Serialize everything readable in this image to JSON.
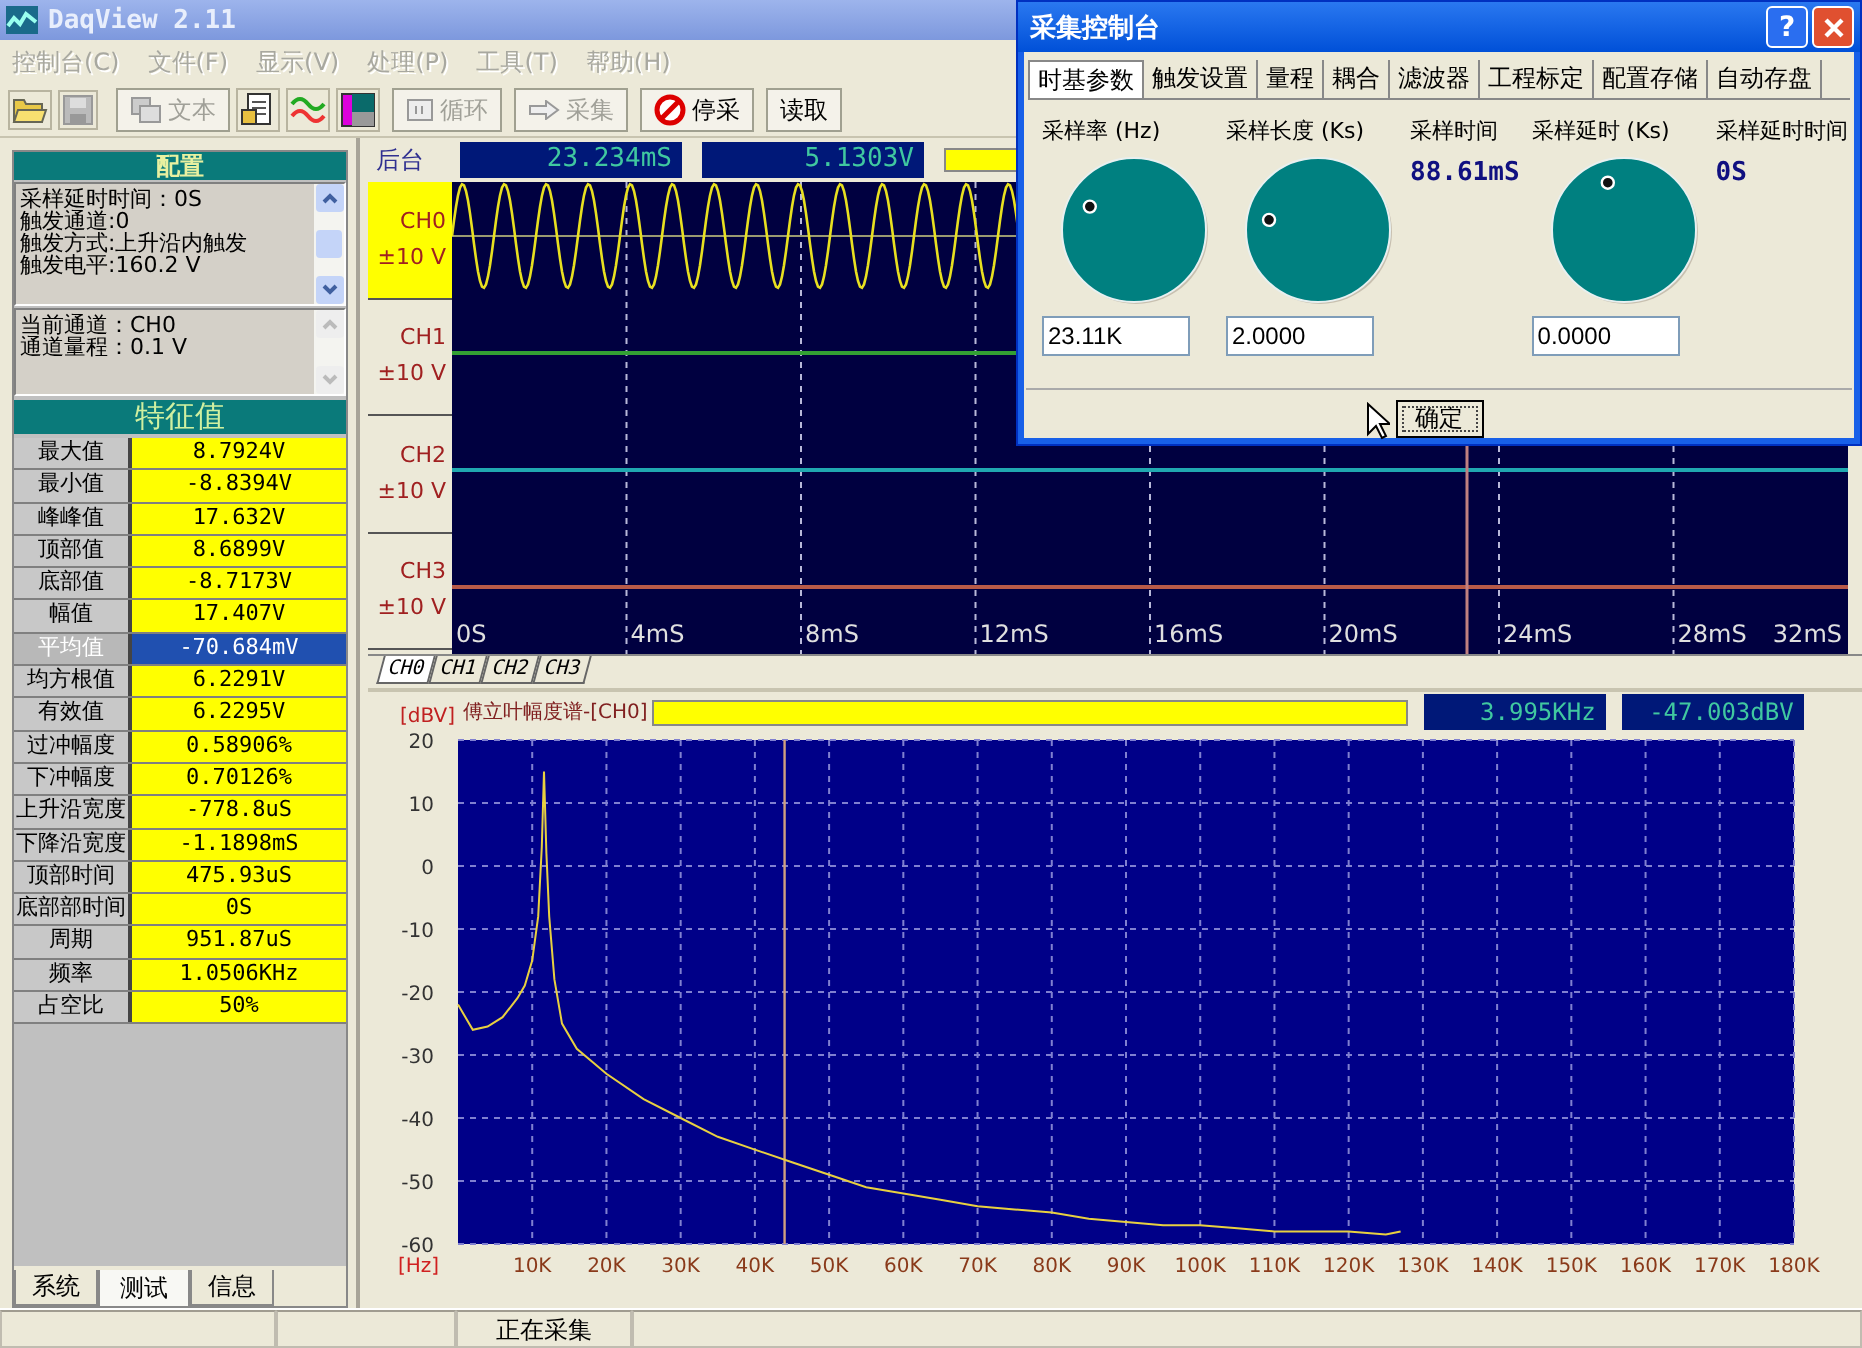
{
  "window": {
    "title": "DaqView 2.11"
  },
  "menu": [
    {
      "label": "控制台(C)",
      "disabled": true
    },
    {
      "label": "文件(F)",
      "disabled": true
    },
    {
      "label": "显示(V)",
      "disabled": true
    },
    {
      "label": "处理(P)",
      "disabled": true
    },
    {
      "label": "工具(T)",
      "disabled": true
    },
    {
      "label": "帮助(H)",
      "disabled": true
    }
  ],
  "toolbar": {
    "buttons": [
      {
        "label": "文本",
        "disabled": true
      },
      {
        "label": "循环",
        "disabled": true
      },
      {
        "label": "采集",
        "disabled": true
      },
      {
        "label": "停采",
        "disabled": false
      },
      {
        "label": "读取",
        "disabled": false
      }
    ]
  },
  "config_panel": {
    "title": "配置",
    "lines": [
      "采样延时时间：0S",
      "触发通道:0",
      "触发方式:上升沿内触发",
      "触发电平:160.2 V"
    ]
  },
  "channel_info": {
    "lines": [
      "当前通道：CH0",
      "通道量程：0.1 V"
    ]
  },
  "features": {
    "title": "特征值",
    "rows": [
      {
        "name": "最大值",
        "value": "8.7924V",
        "selected": false
      },
      {
        "name": "最小值",
        "value": "-8.8394V",
        "selected": false
      },
      {
        "name": "峰峰值",
        "value": "17.632V",
        "selected": false
      },
      {
        "name": "顶部值",
        "value": "8.6899V",
        "selected": false
      },
      {
        "name": "底部值",
        "value": "-8.7173V",
        "selected": false
      },
      {
        "name": "幅值",
        "value": "17.407V",
        "selected": false
      },
      {
        "name": "平均值",
        "value": "-70.684mV",
        "selected": true
      },
      {
        "name": "均方根值",
        "value": "6.2291V",
        "selected": false
      },
      {
        "name": "有效值",
        "value": "6.2295V",
        "selected": false
      },
      {
        "name": "过冲幅度",
        "value": "0.58906%",
        "selected": false
      },
      {
        "name": "下冲幅度",
        "value": "0.70126%",
        "selected": false
      },
      {
        "name": "上升沿宽度",
        "value": "-778.8uS",
        "selected": false
      },
      {
        "name": "下降沿宽度",
        "value": "-1.1898mS",
        "selected": false
      },
      {
        "name": "顶部时间",
        "value": "475.93uS",
        "selected": false
      },
      {
        "name": "底部部时间",
        "value": "0S",
        "selected": false
      },
      {
        "name": "周期",
        "value": "951.87uS",
        "selected": false
      },
      {
        "name": "频率",
        "value": "1.0506KHz",
        "selected": false
      },
      {
        "name": "占空比",
        "value": "50%",
        "selected": false
      }
    ]
  },
  "left_tabs": [
    {
      "label": "系统",
      "selected": false
    },
    {
      "label": "测试",
      "selected": true
    },
    {
      "label": "信息",
      "selected": false
    }
  ],
  "scope": {
    "header_label": "后台",
    "readouts": [
      "23.234mS",
      "5.1303V"
    ],
    "cursor": {
      "level": 0.726
    },
    "channels": [
      {
        "name": "CH0",
        "range": "±10 V",
        "selected": true,
        "color": "#e8e020"
      },
      {
        "name": "CH1",
        "range": "±10 V",
        "selected": false,
        "color": "#33a033"
      },
      {
        "name": "CH2",
        "range": "±10 V",
        "selected": false,
        "color": "#20a8b0"
      },
      {
        "name": "CH3",
        "range": "±10 V",
        "selected": false,
        "color": "#b85a48"
      }
    ],
    "time_ticks": [
      "0S",
      "4mS",
      "8mS",
      "12mS",
      "16mS",
      "20mS",
      "24mS",
      "28mS",
      "32mS"
    ],
    "tabs": [
      {
        "label": "CH0",
        "selected": true
      },
      {
        "label": "CH1",
        "selected": false
      },
      {
        "label": "CH2",
        "selected": false
      },
      {
        "label": "CH3",
        "selected": false
      }
    ]
  },
  "spectrum": {
    "readouts": [
      "3.995KHz",
      "-47.003dBV"
    ],
    "chart_data": {
      "type": "line",
      "title": "傅立叶幅度谱-[CH0]",
      "xlabel": "[Hz]",
      "ylabel": "[dBV]",
      "x": [
        0,
        2000,
        4000,
        6000,
        8000,
        9000,
        10000,
        10800,
        11300,
        11600,
        11900,
        12300,
        13000,
        14000,
        16000,
        18000,
        20000,
        25000,
        30000,
        35000,
        40000,
        45000,
        50000,
        55000,
        60000,
        65000,
        70000,
        75000,
        80000,
        85000,
        90000,
        95000,
        100000,
        105000,
        110000,
        115000,
        120000,
        125000,
        127000
      ],
      "series": [
        {
          "color": "#e8d040",
          "values": [
            -22,
            -26,
            -25.5,
            -24,
            -21,
            -19,
            -15,
            -8,
            3,
            15,
            2,
            -8,
            -18,
            -25,
            -29,
            -31,
            -33,
            -37,
            -40,
            -43,
            -45,
            -47,
            -49,
            -51,
            -52,
            -53,
            -54,
            -54.5,
            -55,
            -56,
            -56.5,
            -57,
            -57,
            -57.5,
            -58,
            -58,
            -58,
            -58.5,
            -58
          ]
        }
      ],
      "xlim": [
        0,
        180000
      ],
      "ylim": [
        -60,
        20
      ],
      "xticks": [
        {
          "value": 10000,
          "label": "10K"
        },
        {
          "value": 20000,
          "label": "20K"
        },
        {
          "value": 30000,
          "label": "30K"
        },
        {
          "value": 40000,
          "label": "40K"
        },
        {
          "value": 50000,
          "label": "50K"
        },
        {
          "value": 60000,
          "label": "60K"
        },
        {
          "value": 70000,
          "label": "70K"
        },
        {
          "value": 80000,
          "label": "80K"
        },
        {
          "value": 90000,
          "label": "90K"
        },
        {
          "value": 100000,
          "label": "100K"
        },
        {
          "value": 110000,
          "label": "110K"
        },
        {
          "value": 120000,
          "label": "120K"
        },
        {
          "value": 130000,
          "label": "130K"
        },
        {
          "value": 140000,
          "label": "140K"
        },
        {
          "value": 150000,
          "label": "150K"
        },
        {
          "value": 160000,
          "label": "160K"
        },
        {
          "value": 170000,
          "label": "170K"
        },
        {
          "value": 180000,
          "label": "180K"
        }
      ],
      "yticks": [
        -60,
        -50,
        -40,
        -30,
        -20,
        -10,
        0,
        10,
        20
      ],
      "grid": true,
      "ref_lines": [
        {
          "axis": "x",
          "value": 44000,
          "color": "#d0a080"
        }
      ]
    }
  },
  "status_bar": {
    "text": "正在采集"
  },
  "dialog": {
    "title": "采集控制台",
    "help_button": "?",
    "tabs": [
      {
        "label": "时基参数",
        "selected": true
      },
      {
        "label": "触发设置",
        "selected": false
      },
      {
        "label": "量程",
        "selected": false
      },
      {
        "label": "耦合",
        "selected": false
      },
      {
        "label": "滤波器",
        "selected": false
      },
      {
        "label": "工程标定",
        "selected": false
      },
      {
        "label": "配置存储",
        "selected": false
      },
      {
        "label": "自动存盘",
        "selected": false
      }
    ],
    "columns": [
      {
        "kind": "knob",
        "label": "采样率 (Hz)",
        "level": 0.27,
        "value": "23.11K"
      },
      {
        "kind": "knob",
        "label": "采样长度 (Ks)",
        "level": 0.21,
        "value": "2.0000"
      },
      {
        "kind": "readout",
        "label": "采样时间",
        "value": "88.61mS"
      },
      {
        "kind": "knob",
        "label": "采样延时 (Ks)",
        "level": 0.43,
        "value": "0.0000"
      },
      {
        "kind": "readout",
        "label": "采样延时时间",
        "value": "0S"
      }
    ],
    "ok_button": "确定"
  }
}
